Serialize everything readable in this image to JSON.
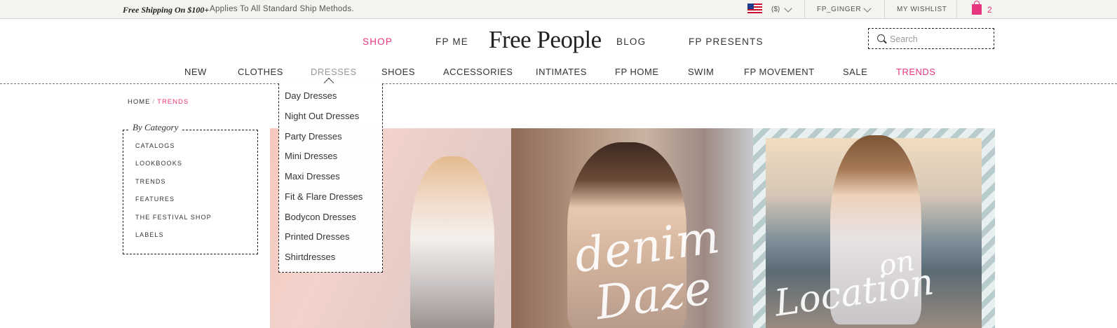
{
  "topbar": {
    "promo_strong": "Free Shipping On $100+",
    "promo_text": "Applies To All Standard Ship Methods.",
    "currency": "($)",
    "account": "FP_GINGER",
    "wishlist": "MY WISHLIST",
    "bag_count": "2"
  },
  "primary_nav": {
    "shop": "SHOP",
    "fp_me": "FP ME",
    "logo": "Free People",
    "blog": "BLOG",
    "fp_presents": "FP PRESENTS"
  },
  "search": {
    "placeholder": "Search"
  },
  "category_nav": {
    "new": "NEW",
    "clothes": "CLOTHES",
    "dresses": "DRESSES",
    "shoes": "SHOES",
    "accessories": "ACCESSORIES",
    "intimates": "INTIMATES",
    "fp_home": "FP HOME",
    "swim": "SWIM",
    "fp_movement": "FP MOVEMENT",
    "sale": "SALE",
    "trends": "TRENDS"
  },
  "breadcrumb": {
    "home": "HOME",
    "separator": "/",
    "current": "TRENDS"
  },
  "sidebar": {
    "title": "By Category",
    "items": [
      "CATALOGS",
      "LOOKBOOKS",
      "TRENDS",
      "FEATURES",
      "THE FESTIVAL SHOP",
      "LABELS"
    ]
  },
  "dropdown": {
    "items": [
      "Day Dresses",
      "Night Out Dresses",
      "Party Dresses",
      "Mini Dresses",
      "Maxi Dresses",
      "Fit & Flare Dresses",
      "Bodycon Dresses",
      "Printed Dresses",
      "Shirtdresses"
    ]
  },
  "hero": {
    "panel2_line1": "denim",
    "panel2_line2": "Daze",
    "panel3_line1": "on",
    "panel3_line2": "Location"
  },
  "colors": {
    "accent": "#e8357f",
    "topbar_bg": "#f4f3ef"
  }
}
